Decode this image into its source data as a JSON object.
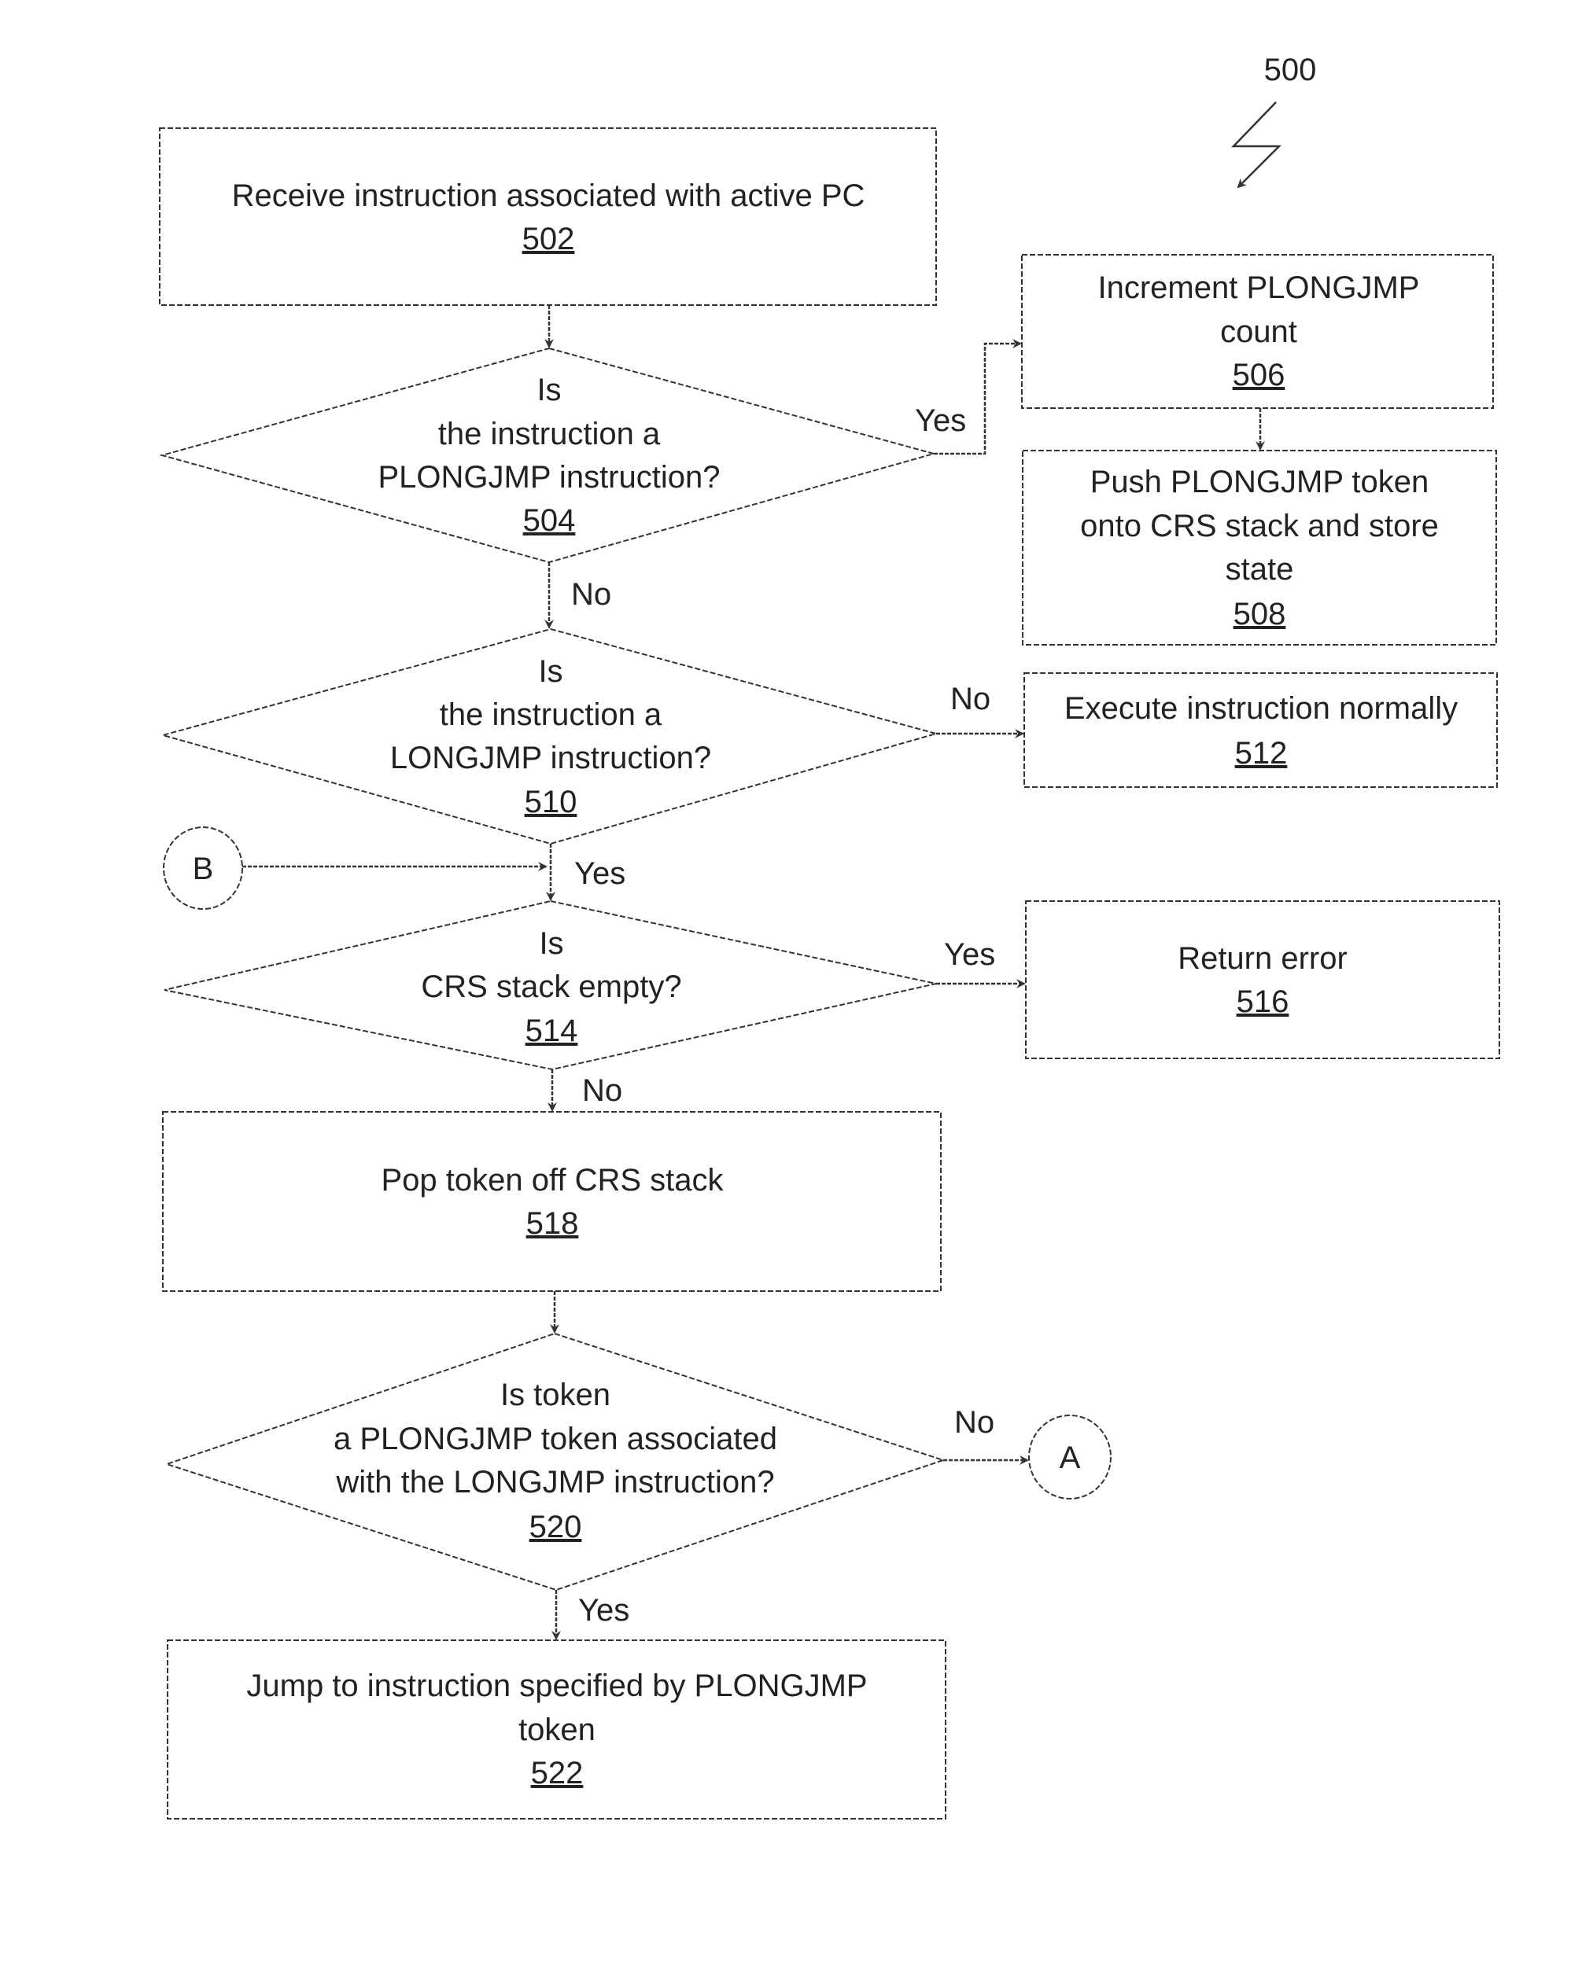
{
  "figure": {
    "reference": "500",
    "nodes": {
      "n502": {
        "lines": [
          "Receive instruction associated with active PC"
        ],
        "number": "502"
      },
      "n504": {
        "lines": [
          "Is",
          "the instruction a",
          "PLONGJMP instruction?"
        ],
        "number": "504"
      },
      "n506": {
        "lines": [
          "Increment PLONGJMP",
          "count"
        ],
        "number": "506"
      },
      "n508": {
        "lines": [
          "Push PLONGJMP token",
          "onto CRS stack and store",
          "state"
        ],
        "number": "508"
      },
      "n510": {
        "lines": [
          "Is",
          "the instruction a",
          "LONGJMP instruction?"
        ],
        "number": "510"
      },
      "n512": {
        "lines": [
          "Execute instruction normally"
        ],
        "number": "512"
      },
      "n514": {
        "lines": [
          "Is",
          "CRS stack empty?"
        ],
        "number": "514"
      },
      "n516": {
        "lines": [
          "Return error"
        ],
        "number": "516"
      },
      "n518": {
        "lines": [
          "Pop token off CRS stack"
        ],
        "number": "518"
      },
      "n520": {
        "lines": [
          "Is token",
          "a PLONGJMP token associated",
          "with the LONGJMP instruction?"
        ],
        "number": "520"
      },
      "n522": {
        "lines": [
          "Jump to instruction specified by PLONGJMP",
          "token"
        ],
        "number": "522"
      }
    },
    "connectors": {
      "A": "A",
      "B": "B"
    },
    "edge_labels": {
      "e504_yes": "Yes",
      "e504_no": "No",
      "e510_no": "No",
      "e510_yes": "Yes",
      "e514_yes": "Yes",
      "e514_no": "No",
      "e520_no": "No",
      "e520_yes": "Yes"
    }
  }
}
